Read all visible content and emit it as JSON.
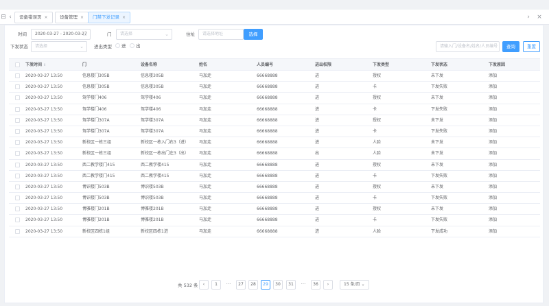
{
  "tabs": [
    {
      "label": "设备错误页",
      "close": "×"
    },
    {
      "label": "设备管理",
      "close": "×"
    },
    {
      "label": "门禁下发记录",
      "close": "×",
      "active": true
    }
  ],
  "tabbar_icons": {
    "menu": "⊟",
    "prev": "‹",
    "next": "›",
    "close": "×"
  },
  "filters": {
    "time_label": "时间",
    "time_value": "2020-03-27 - 2020-03-27",
    "door_label": "门",
    "door_placeholder": "请选择",
    "address_label": "住址",
    "address_placeholder": "请选择地址",
    "select_button": "选择",
    "status_label": "下发状态",
    "status_placeholder": "请选择",
    "inout_label": "进出类型",
    "radio_in": "进",
    "radio_out": "出",
    "search_placeholder": "请输入门/设备名/姓名/人员编号",
    "query_button": "查询",
    "reset_button": "重置"
  },
  "table": {
    "headers": [
      "下发时间",
      "门",
      "设备名称",
      "姓名",
      "人员编号",
      "进出权限",
      "下发类型",
      "下发状态",
      "下发原因"
    ],
    "rows": [
      [
        "2020-03-27 13:50",
        "信息楼门305B",
        "信息楼305B",
        "马加走",
        "66668888",
        "进",
        "授权",
        "未下发",
        "添加"
      ],
      [
        "2020-03-27 13:50",
        "信息楼门305B",
        "信息楼305B",
        "马加走",
        "66668888",
        "进",
        "卡",
        "下发失败",
        "添加"
      ],
      [
        "2020-03-27 13:50",
        "驾学楼门406",
        "驾学楼406",
        "马加走",
        "66668888",
        "进",
        "授权",
        "未下发",
        "添加"
      ],
      [
        "2020-03-27 13:50",
        "驾学楼门406",
        "驾学楼406",
        "马加走",
        "66668888",
        "进",
        "卡",
        "下发失败",
        "添加"
      ],
      [
        "2020-03-27 13:50",
        "驾学楼门307A",
        "驾学楼307A",
        "马加走",
        "66668888",
        "进",
        "授权",
        "未下发",
        "添加"
      ],
      [
        "2020-03-27 13:50",
        "驾学楼门307A",
        "驾学楼307A",
        "马加走",
        "66668888",
        "进",
        "卡",
        "下发失败",
        "添加"
      ],
      [
        "2020-03-27 13:50",
        "新校区一栋三组",
        "新校区一栋入门右3（进）",
        "马加走",
        "66668888",
        "进",
        "人脸",
        "未下发",
        "添加"
      ],
      [
        "2020-03-27 13:50",
        "新校区一栋三组",
        "新校区一栋出门左3（出）",
        "马加走",
        "66668888",
        "出",
        "人脸",
        "未下发",
        "添加"
      ],
      [
        "2020-03-27 13:50",
        "西二教学楼门415",
        "西二教学楼415",
        "马加走",
        "66668888",
        "进",
        "授权",
        "未下发",
        "添加"
      ],
      [
        "2020-03-27 13:50",
        "西二教学楼门415",
        "西二教学楼415",
        "马加走",
        "66668888",
        "进",
        "卡",
        "下发失败",
        "添加"
      ],
      [
        "2020-03-27 13:50",
        "博识楼门503B",
        "博识楼503B",
        "马加走",
        "66668888",
        "进",
        "授权",
        "未下发",
        "添加"
      ],
      [
        "2020-03-27 13:50",
        "博识楼门503B",
        "博识楼503B",
        "马加走",
        "66668888",
        "进",
        "卡",
        "下发失败",
        "添加"
      ],
      [
        "2020-03-27 13:50",
        "博雅楼门201B",
        "博雅楼201B",
        "马加走",
        "66668888",
        "进",
        "授权",
        "未下发",
        "添加"
      ],
      [
        "2020-03-27 13:50",
        "博雅楼门201B",
        "博雅楼201B",
        "马加走",
        "66668888",
        "进",
        "卡",
        "下发失败",
        "添加"
      ],
      [
        "2020-03-27 13:50",
        "新校区四栋1组",
        "新校区四栋1进",
        "马加走",
        "66668888",
        "进",
        "人脸",
        "下发成功",
        "添加"
      ]
    ]
  },
  "pagination": {
    "total": "共 532 条",
    "prev": "‹",
    "next": "›",
    "more": "···",
    "pages": [
      "1",
      "27",
      "28",
      "29",
      "30",
      "31",
      "36"
    ],
    "active_page": "29",
    "page_size": "15 条/页"
  },
  "colors": {
    "accent": "#409eff",
    "border": "#dcdfe6",
    "header_bg": "#f5f7fa"
  }
}
